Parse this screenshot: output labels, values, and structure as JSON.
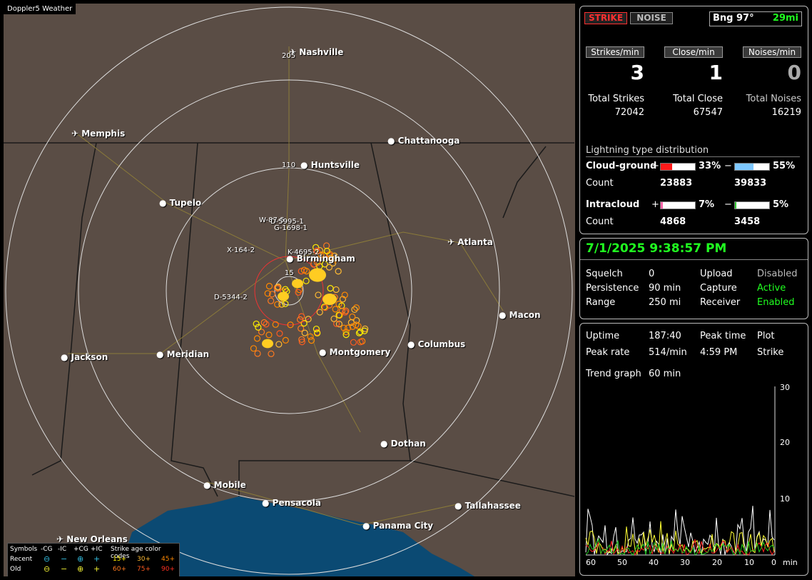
{
  "app_title": "Doppler5 Weather",
  "map": {
    "cities": [
      {
        "name": "Nashville",
        "icon": "airport"
      },
      {
        "name": "Memphis",
        "icon": "airport"
      },
      {
        "name": "Chattanooga",
        "icon": "dot"
      },
      {
        "name": "Huntsville",
        "icon": "dot"
      },
      {
        "name": "Tupelo",
        "icon": "dot"
      },
      {
        "name": "Atlanta",
        "icon": "airport"
      },
      {
        "name": "Birmingham",
        "icon": "dot"
      },
      {
        "name": "Macon",
        "icon": "dot"
      },
      {
        "name": "Jackson",
        "icon": "dot"
      },
      {
        "name": "Meridian",
        "icon": "dot"
      },
      {
        "name": "Montgomery",
        "icon": "dot"
      },
      {
        "name": "Columbus",
        "icon": "dot"
      },
      {
        "name": "Dothan",
        "icon": "dot"
      },
      {
        "name": "Mobile",
        "icon": "dot"
      },
      {
        "name": "Pensacola",
        "icon": "dot"
      },
      {
        "name": "Tallahassee",
        "icon": "dot"
      },
      {
        "name": "Panama City",
        "icon": "dot"
      },
      {
        "name": "New Orleans",
        "icon": "airport"
      }
    ],
    "range_labels": [
      "205",
      "110",
      "15"
    ],
    "cell_labels": [
      "W-87-5",
      "D-5995-1",
      "G-1698-1",
      "X-164-2",
      "K-4695-2",
      "D-5344-2"
    ],
    "legend": {
      "title_symbols": "Symbols",
      "cols": [
        "-CG",
        "-IC",
        "+CG",
        "+IC"
      ],
      "age_title": "Strike age color codes",
      "recent_label": "Recent",
      "old_label": "Old",
      "recent_ages": [
        "15+",
        "30+",
        "45+"
      ],
      "old_ages": [
        "60+",
        "75+",
        "90+"
      ],
      "age_colors": [
        "#ffee00",
        "#ffbb33",
        "#ff8800",
        "#ff7a1f",
        "#ff5a1f",
        "#ff3020"
      ],
      "recent_symbols": [
        "⊖",
        "−",
        "⊕",
        "+"
      ],
      "old_symbols": [
        "⊖",
        "−",
        "⊕",
        "+"
      ]
    }
  },
  "status": {
    "strike_label": "STRIKE",
    "noise_label": "NOISE",
    "bearing": "Bng 97°",
    "distance": "29mi",
    "rate_labels": [
      "Strikes/min",
      "Close/min",
      "Noises/min"
    ],
    "rates": [
      "3",
      "1",
      "0"
    ],
    "total_labels": [
      "Total Strikes",
      "Total Close",
      "Total Noises"
    ],
    "totals": [
      "72042",
      "67547",
      "16219"
    ],
    "dist_title": "Lightning type distribution",
    "cg_label": "Cloud-ground",
    "ic_label": "Intracloud",
    "count_label": "Count",
    "cg_pos_pct": "33%",
    "cg_neg_pct": "55%",
    "ic_pos_pct": "7%",
    "ic_neg_pct": "5%",
    "cg_pos_frac": 0.33,
    "cg_neg_frac": 0.55,
    "ic_pos_frac": 0.07,
    "ic_neg_frac": 0.05,
    "cg_pos_count": "23883",
    "cg_neg_count": "39833",
    "ic_pos_count": "4868",
    "ic_neg_count": "3458",
    "plus": "+",
    "minus": "−"
  },
  "settings": {
    "datetime": "7/1/2025 9:38:57 PM",
    "squelch_label": "Squelch",
    "squelch": "0",
    "persistence_label": "Persistence",
    "persistence": "90 min",
    "range_label": "Range",
    "range": "250 mi",
    "upload_label": "Upload",
    "upload": "Disabled",
    "capture_label": "Capture",
    "capture": "Active",
    "receiver_label": "Receiver",
    "receiver": "Enabled"
  },
  "trend": {
    "uptime_label": "Uptime",
    "uptime": "187:40",
    "peak_time_label": "Peak time",
    "plot_label": "Plot",
    "peak_rate_label": "Peak rate",
    "peak_rate": "514/min",
    "peak_time": "4:59 PM",
    "plot": "Strike",
    "trend_label": "Trend graph",
    "trend_value": "60 min",
    "y_ticks": [
      "30",
      "20",
      "10"
    ],
    "x_ticks": [
      "60",
      "50",
      "40",
      "30",
      "20",
      "10",
      "0"
    ],
    "x_unit": "min"
  },
  "colors": {
    "strike_red": "#ff3030",
    "green": "#20ff20",
    "cg_pos": "#ff1a1a",
    "cg_neg": "#7ec8ff",
    "ic_pos": "#ff66aa",
    "ic_neg": "#33cc33"
  }
}
